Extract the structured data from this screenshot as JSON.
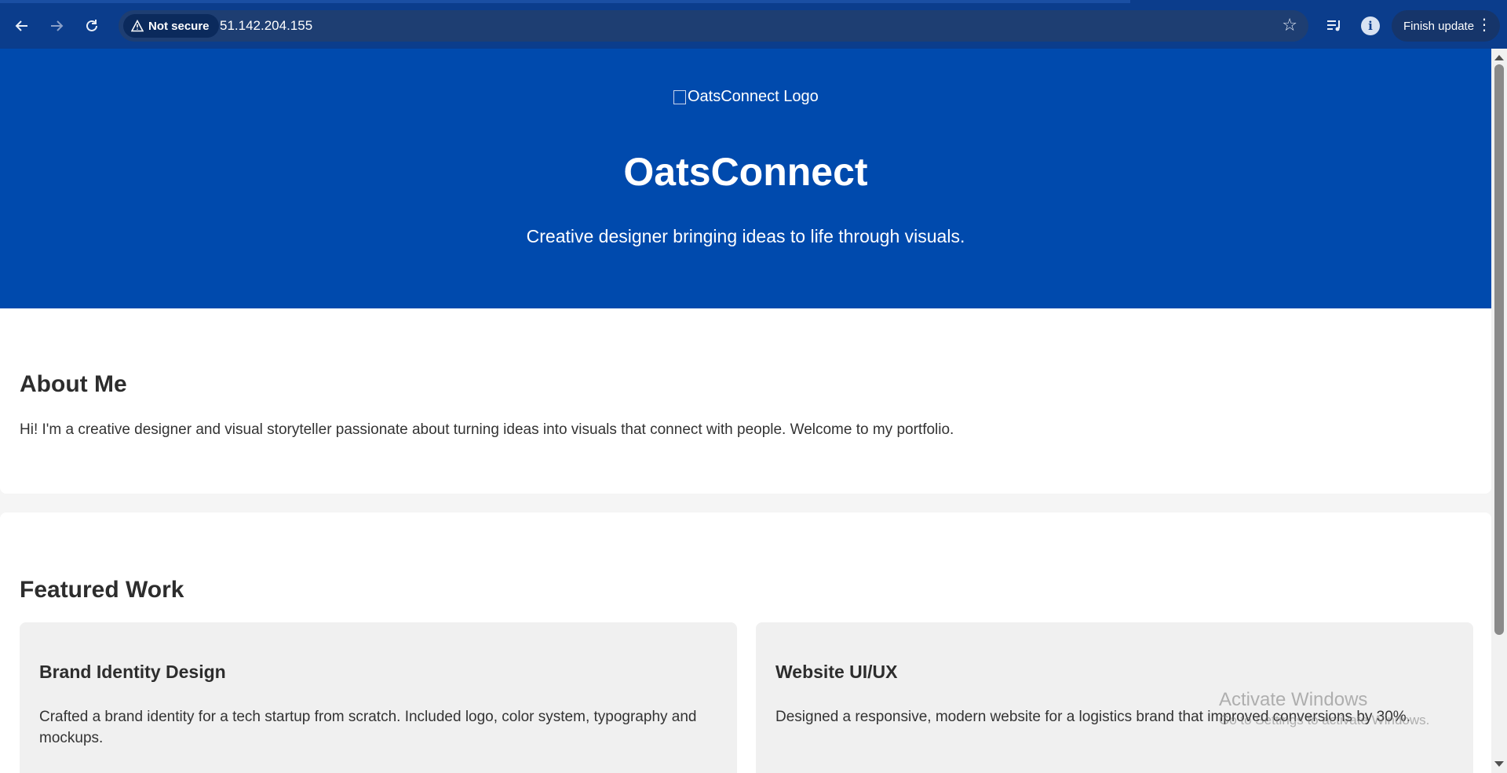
{
  "browser": {
    "security_label": "Not secure",
    "url": "51.142.204.155",
    "finish_update_label": "Finish update"
  },
  "icons": {
    "back": "back-arrow-icon",
    "forward": "forward-arrow-icon",
    "reload": "reload-icon",
    "warning": "warning-triangle-icon",
    "bookmark": "star-icon",
    "media": "media-queue-icon",
    "profile": "info-icon",
    "menu": "kebab-menu-icon"
  },
  "colors": {
    "chrome": "#0b3d8c",
    "hero": "#004aad",
    "card": "#f0f0f0"
  },
  "hero": {
    "logo_alt": "OatsConnect Logo",
    "title": "OatsConnect",
    "subtitle": "Creative designer bringing ideas to life through visuals."
  },
  "about": {
    "heading": "About Me",
    "body": "Hi! I'm a creative designer and visual storyteller passionate about turning ideas into visuals that connect with people. Welcome to my portfolio."
  },
  "work": {
    "heading": "Featured Work",
    "cards": [
      {
        "title": "Brand Identity Design",
        "description": "Crafted a brand identity for a tech startup from scratch. Included logo, color system, typography and mockups."
      },
      {
        "title": "Website UI/UX",
        "description": "Designed a responsive, modern website for a logistics brand that improved conversions by 30%."
      }
    ]
  },
  "watermark": {
    "title": "Activate Windows",
    "subtitle": "Go to Settings to activate Windows."
  }
}
